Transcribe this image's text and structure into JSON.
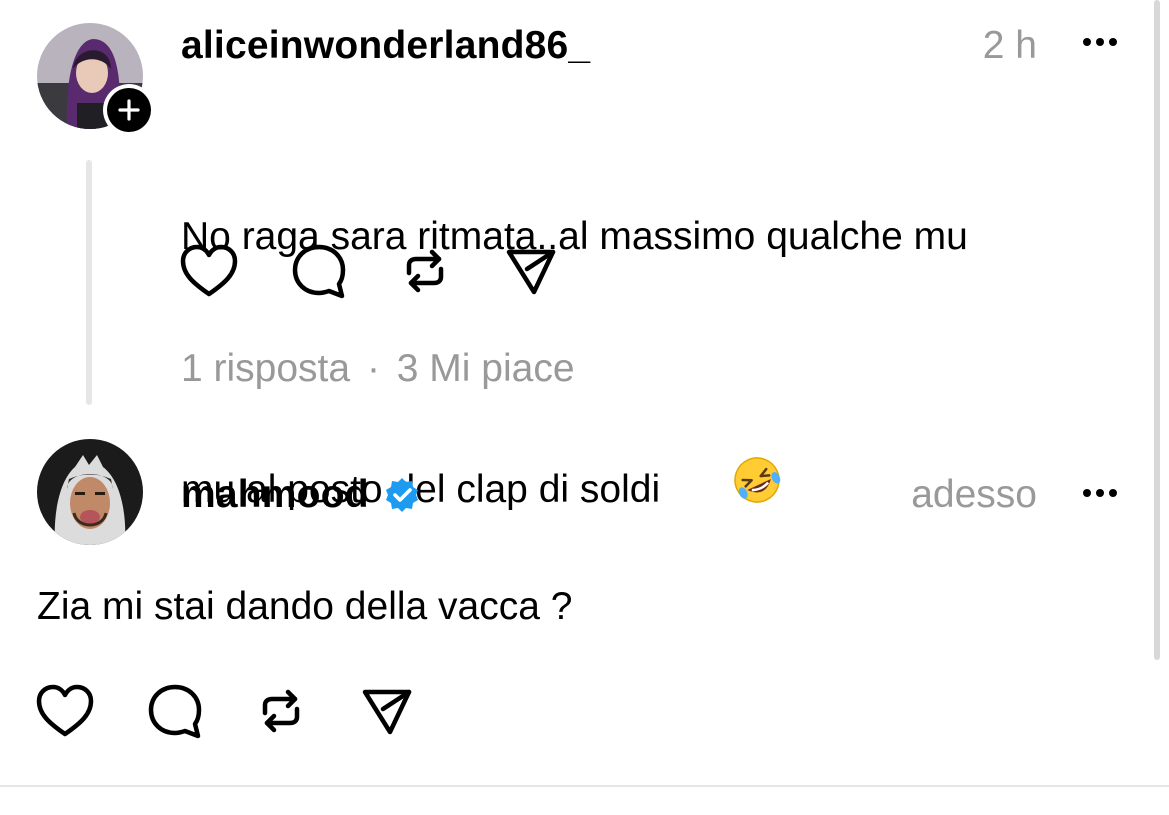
{
  "comment1": {
    "username": "aliceinwonderland86_",
    "timestamp": "2 h",
    "text_line1": "No raga sara ritmata..al massimo qualche mu",
    "text_line2": "mu al posto del clap di soldi",
    "emoji": "rolling-on-floor-laughing",
    "replies": "1 risposta",
    "separator": "·",
    "likes": "3 Mi piace"
  },
  "comment2": {
    "username": "mahmood",
    "verified": true,
    "timestamp": "adesso",
    "text": "Zia mi stai dando della vacca ?"
  },
  "icons": {
    "like": "heart-icon",
    "reply": "comment-bubble-icon",
    "repost": "repost-icon",
    "share": "send-icon",
    "more": "more-dots-icon",
    "follow": "plus-icon",
    "verified": "verified-badge-icon"
  },
  "colors": {
    "text": "#000000",
    "muted": "#999999",
    "verified_blue": "#1d9bf0",
    "thread_line": "#e6e6e6"
  }
}
